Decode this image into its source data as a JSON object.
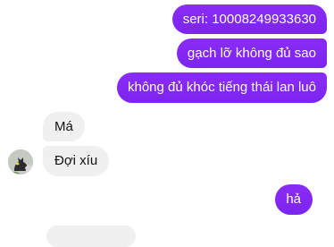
{
  "messages": [
    {
      "direction": "outgoing",
      "text": "seri: 10008249933630"
    },
    {
      "direction": "outgoing",
      "text": "gạch lỡ không đủ sao"
    },
    {
      "direction": "outgoing",
      "text": "không đủ khóc tiếng thái lan luô"
    },
    {
      "direction": "incoming",
      "text": "Má"
    },
    {
      "direction": "incoming",
      "text": "Đợi xíu"
    },
    {
      "direction": "outgoing",
      "text": "hả"
    }
  ],
  "colors": {
    "outgoing_bubble": "#7f27f2",
    "incoming_bubble": "#f0f0f0",
    "outgoing_text": "#ffffff",
    "incoming_text": "#111111"
  },
  "avatar_icon": "contact-avatar"
}
